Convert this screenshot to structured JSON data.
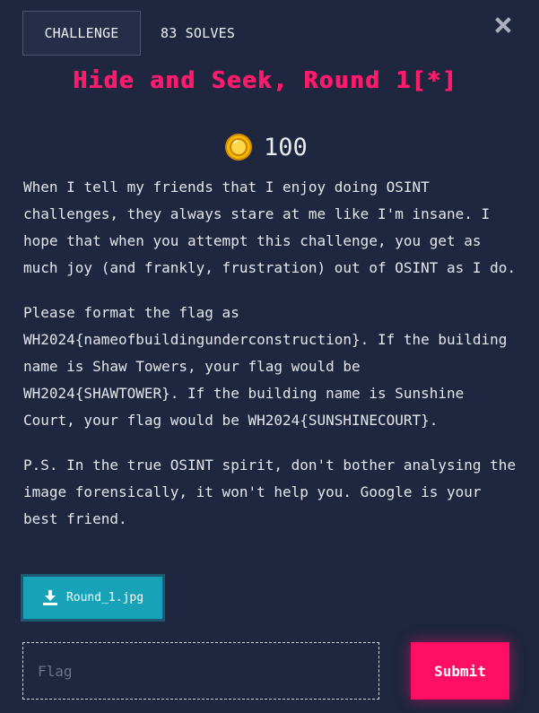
{
  "tabs": {
    "challenge_label": "CHALLENGE",
    "solves_label": "83 SOLVES"
  },
  "close_icon": "close-icon",
  "challenge": {
    "title": "Hide and Seek, Round 1[*]",
    "points": "100",
    "coin_icon": "coin-icon",
    "description": [
      "When I tell my friends that I enjoy doing OSINT challenges, they always stare at me like I'm insane. I hope that when you attempt this challenge, you get as much joy (and frankly, frustration) out of OSINT as I do.",
      "Please format the flag as WH2024{nameofbuildingunderconstruction}. If the building name is Shaw Towers, your flag would be WH2024{SHAWTOWER}. If the building name is Sunshine Court, your flag would be WH2024{SUNSHINECOURT}.",
      "P.S. In the true OSINT spirit, don't bother analysing the image forensically, it won't help you. Google is your best friend."
    ]
  },
  "attachment": {
    "icon": "download-icon",
    "filename": "Round_1.jpg"
  },
  "flag_form": {
    "placeholder": "Flag",
    "value": "",
    "submit_label": "Submit"
  },
  "colors": {
    "background": "#1e2640",
    "accent_pink": "#ff0f64",
    "download_teal": "#17a2b8",
    "coin_gold": "#f5b800"
  }
}
